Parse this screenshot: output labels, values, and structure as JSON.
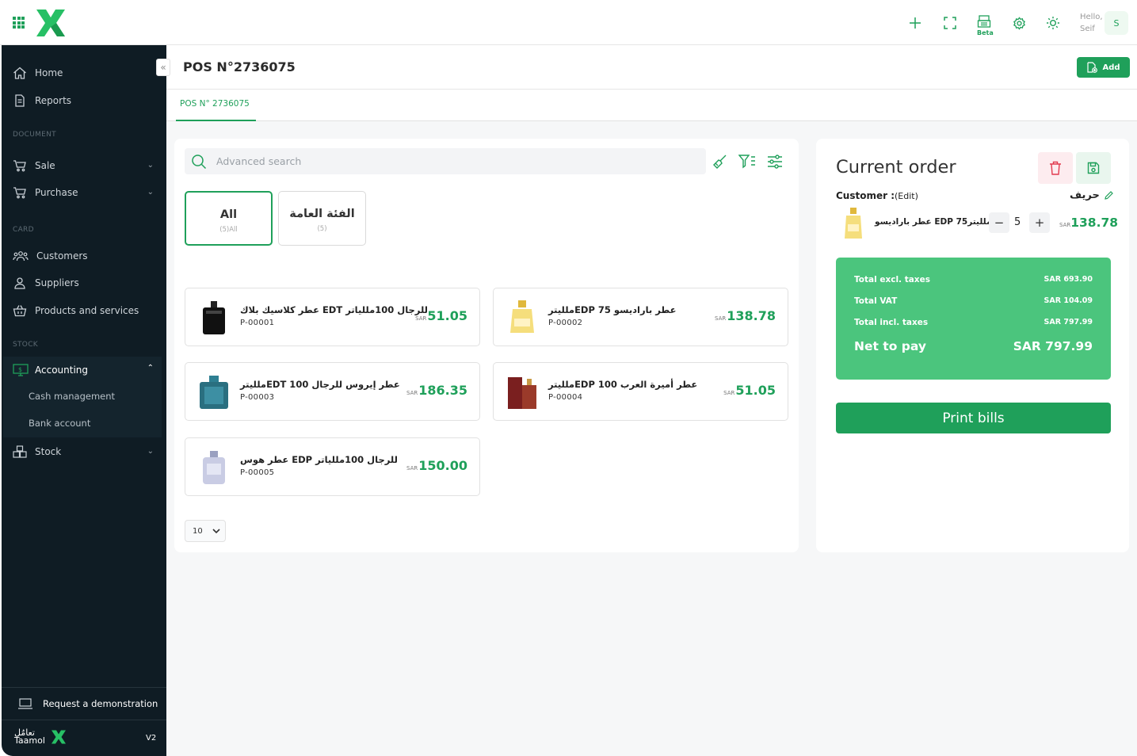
{
  "topbar": {
    "icons": [
      "grid-icon",
      "plus-icon",
      "fullscreen-icon",
      "register-icon",
      "settings-icon",
      "sun-icon"
    ],
    "beta_label": "Beta",
    "hello": "Hello,",
    "user": "Seif",
    "avatar": "S"
  },
  "sidebar": {
    "home": "Home",
    "reports": "Reports",
    "sec_document": "DOCUMENT",
    "sale": "Sale",
    "purchase": "Purchase",
    "sec_card": "CARD",
    "customers": "Customers",
    "suppliers": "Suppliers",
    "products": "Products and services",
    "sec_stock": "STOCK",
    "accounting": "Accounting",
    "cash": "Cash management",
    "bank": "Bank account",
    "stock": "Stock",
    "demo": "Request a demonstration",
    "brand_ar": "تعامُل",
    "brand": "Taamol",
    "version": "V2"
  },
  "page": {
    "title": "POS N°2736075",
    "add": "Add",
    "tab": "POS N° 2736075"
  },
  "search": {
    "placeholder": "Advanced search"
  },
  "categories": [
    {
      "name": "All",
      "count": "(5)All"
    },
    {
      "name": "الفئة العامة",
      "count": "(5)"
    }
  ],
  "products": [
    {
      "name": "للرجال 100مللياتر EDT عطر كلاسيك بلاك",
      "code": "P-00001",
      "currency": "SAR",
      "price": "51.05"
    },
    {
      "name": "عطر باراديسو EDP 75ملليتر",
      "code": "P-00002",
      "currency": "SAR",
      "price": "138.78"
    },
    {
      "name": "عطر إيروس للرجال EDT 100ملليتر",
      "code": "P-00003",
      "currency": "SAR",
      "price": "186.35"
    },
    {
      "name": "عطر أميرة العرب EDP 100ملليتر",
      "code": "P-00004",
      "currency": "SAR",
      "price": "51.05"
    },
    {
      "name": "للرجال 100مللياتر EDP عطر هوس",
      "code": "P-00005",
      "currency": "SAR",
      "price": "150.00"
    }
  ],
  "per_page": "10",
  "order": {
    "title": "Current order",
    "customer_label": "Customer :",
    "customer_edit": "(Edit)",
    "customer_name": "حريف",
    "line": {
      "name": "عطر باراديسو EDP 75ملليتر",
      "qty": "5",
      "currency": "SAR",
      "price": "138.78"
    },
    "totals": {
      "excl_label": "Total excl. taxes",
      "excl": "SAR 693.90",
      "vat_label": "Total VAT",
      "vat": "SAR 104.09",
      "incl_label": "Total incl. taxes",
      "incl": "SAR 797.99",
      "net_label": "Net to pay",
      "net": "SAR 797.99"
    },
    "print": "Print bills"
  },
  "colors": {
    "accent": "#1fa05a",
    "totals_bg": "#4bc57d",
    "sidebar": "#0f1c24"
  }
}
